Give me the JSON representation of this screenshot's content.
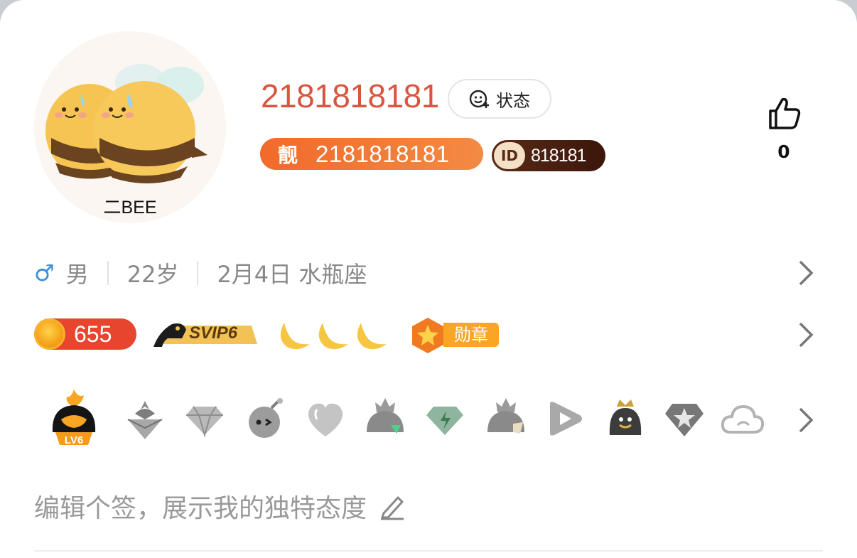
{
  "profile": {
    "avatar_caption": "二BEE",
    "nickname": "2181818181",
    "status_label": "状态",
    "pretty_tag": "靓",
    "pretty_number": "2181818181",
    "id_label": "ID",
    "id_number": "818181",
    "like_count": "0"
  },
  "info": {
    "gender_symbol": "♂",
    "gender": "男",
    "age": "22岁",
    "birthday": "2月4日 水瓶座"
  },
  "badges": {
    "level": "655",
    "svip": "SVIP6",
    "moon_count": 3,
    "medal": "勋章"
  },
  "icons": {
    "lv_badge": "LV6",
    "names": [
      "qq-lv6-icon",
      "flame-diamond-icon",
      "diamond-icon",
      "bomb-icon",
      "heart-icon",
      "hat-icon",
      "green-diamond-icon",
      "hat-ribbon-icon",
      "video-play-icon",
      "crown-penguin-icon",
      "star-diamond-icon",
      "cloud-icon"
    ]
  },
  "bio": {
    "placeholder": "编辑个签，展示我的独特态度"
  },
  "colors": {
    "nickname": "#d9553f",
    "pretty_badge": "#f26a2b",
    "id_badge": "#4a1f10",
    "gender": "#3b8fd9"
  }
}
